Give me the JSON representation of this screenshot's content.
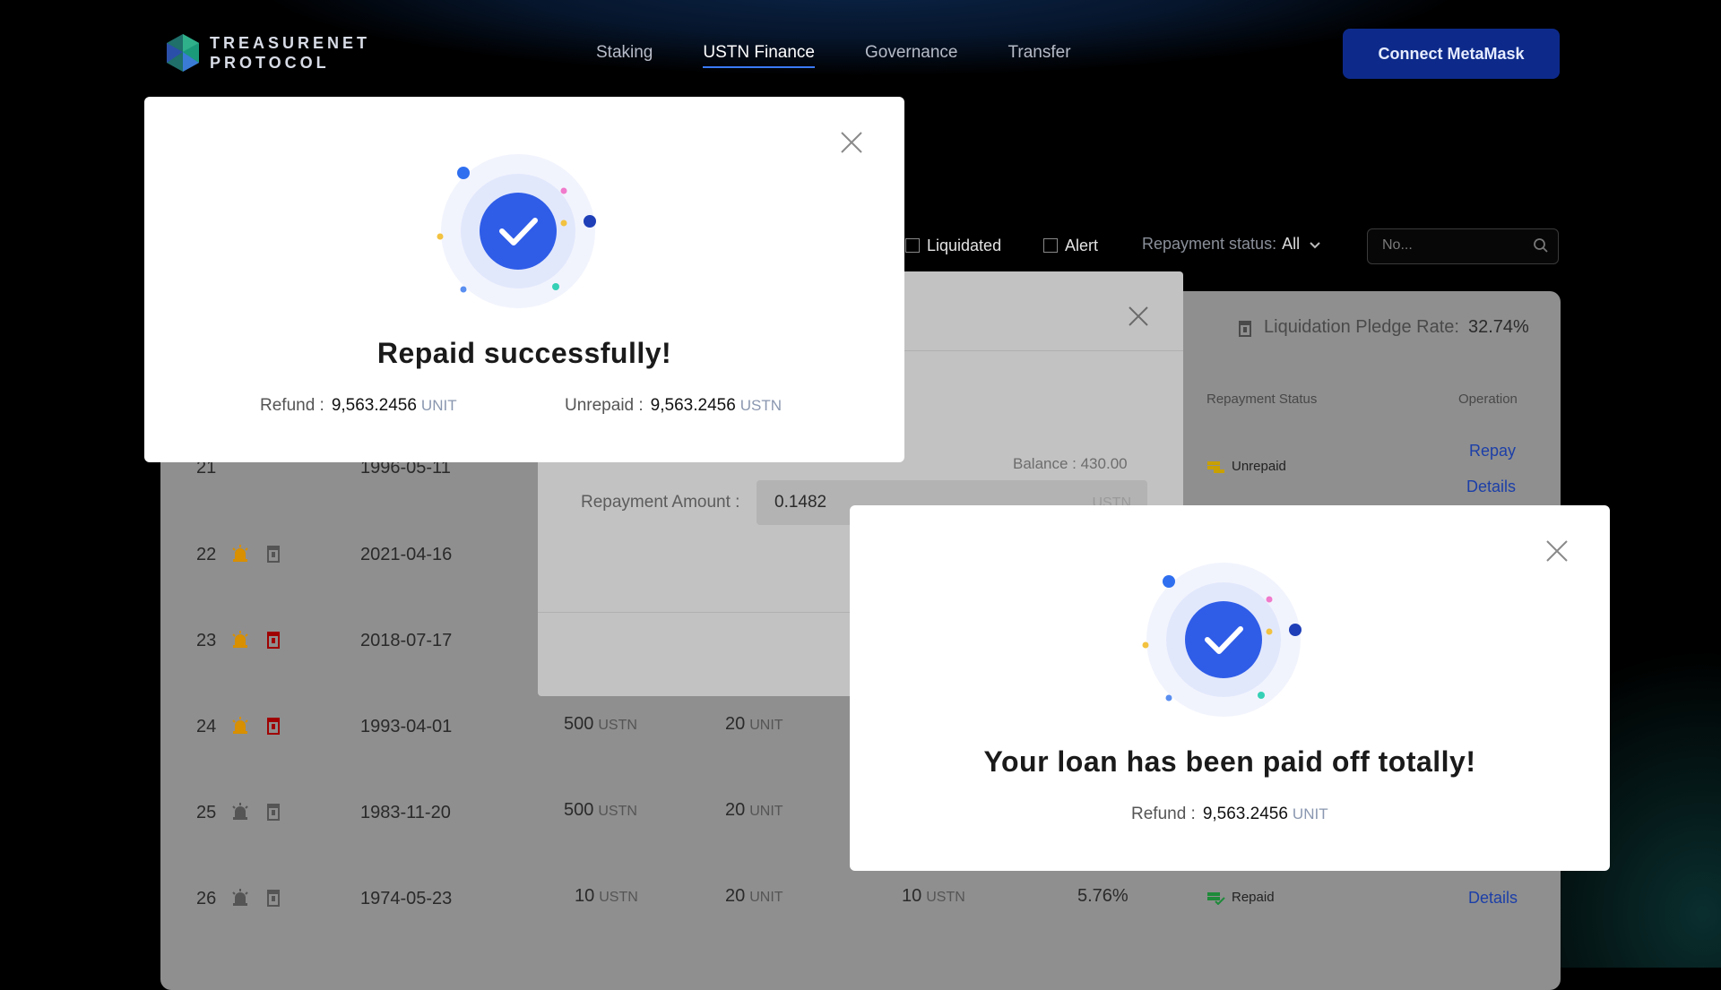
{
  "brand": {
    "line1": "TREASURENET",
    "line2": "PROTOCOL"
  },
  "nav": [
    {
      "label": "Staking",
      "active": false
    },
    {
      "label": "USTN Finance",
      "active": true
    },
    {
      "label": "Governance",
      "active": false
    },
    {
      "label": "Transfer",
      "active": false
    }
  ],
  "connect_label": "Connect MetaMask",
  "filters": {
    "liquidated": "Liquidated",
    "alert": "Alert",
    "status_label": "Repayment status:",
    "status_value": "All",
    "search_placeholder": "No..."
  },
  "pledge": {
    "label": "Liquidation Pledge Rate:",
    "value": "32.74%"
  },
  "table": {
    "headers": {
      "status": "Repayment Status",
      "operation": "Operation"
    },
    "rows": [
      {
        "no": "21",
        "date": "1996-05-11",
        "status": "Unrepaid",
        "repay": "Repay",
        "details": "Details"
      },
      {
        "no": "22",
        "date": "2021-04-16"
      },
      {
        "no": "23",
        "date": "2018-07-17"
      },
      {
        "no": "24",
        "date": "1993-04-01",
        "loan": "500",
        "loan_unit": "USTN",
        "pledge": "20",
        "pledge_unit": "UNIT"
      },
      {
        "no": "25",
        "date": "1983-11-20",
        "loan": "500",
        "loan_unit": "USTN",
        "pledge": "20",
        "pledge_unit": "UNIT"
      },
      {
        "no": "26",
        "date": "1974-05-23",
        "loan": "10",
        "loan_unit": "USTN",
        "pledge": "20",
        "pledge_unit": "UNIT",
        "repaid_amt": "10",
        "repaid_unit": "USTN",
        "rate": "5.76%",
        "status": "Repaid",
        "details": "Details"
      }
    ]
  },
  "repay_modal": {
    "balance": "Balance : 430.00",
    "amount_label": "Repayment Amount :",
    "amount_value": "0.1482",
    "amount_unit": "USTN"
  },
  "modal1": {
    "title": "Repaid successfully!",
    "refund_label": "Refund :",
    "refund_value": "9,563.2456",
    "refund_unit": "UNIT",
    "unpaid_label": "Unrepaid :",
    "unpaid_value": "9,563.2456",
    "unpaid_unit": "USTN"
  },
  "modal2": {
    "title": "Your loan has been paid off totally!",
    "refund_label": "Refund :",
    "refund_value": "9,563.2456",
    "refund_unit": "UNIT"
  },
  "colors": {
    "accent": "#2f5de8",
    "brand_button": "#0d2a8a",
    "link": "#1c3fa8"
  }
}
